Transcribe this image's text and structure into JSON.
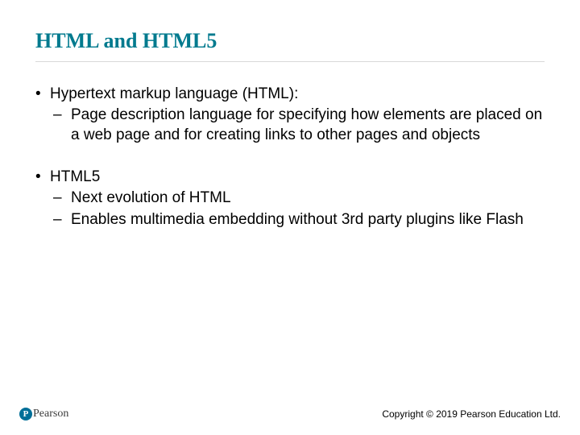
{
  "slide": {
    "title": "HTML and HTML5",
    "bullets": [
      {
        "text": "Hypertext markup language (HTML):",
        "sub": [
          "Page description language for specifying how elements are placed on a web page and for creating links to other pages and objects"
        ]
      },
      {
        "text": "HTML5",
        "sub": [
          "Next evolution of HTML",
          "Enables multimedia embedding without 3rd party plugins like Flash"
        ]
      }
    ]
  },
  "footer": {
    "logo_mark": "P",
    "logo_text": "Pearson",
    "copyright": "Copyright © 2019 Pearson Education Ltd."
  }
}
